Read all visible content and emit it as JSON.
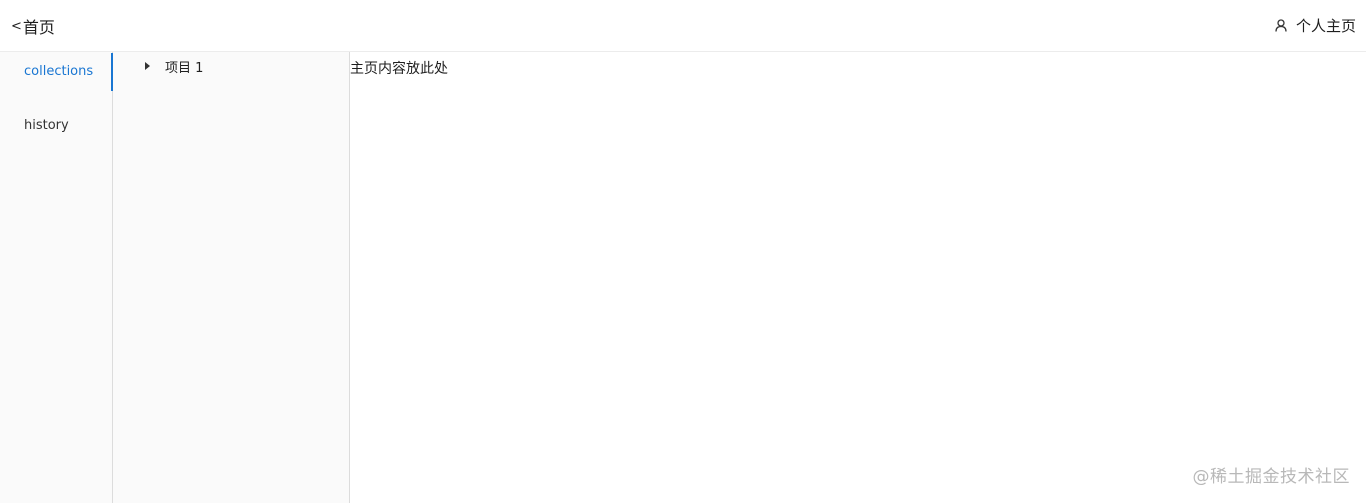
{
  "header": {
    "back_chevron": "<",
    "back_label": "首页",
    "profile_label": "个人主页",
    "profile_icon": "user-icon"
  },
  "sidebar": {
    "items": [
      {
        "label": "collections",
        "active": true
      },
      {
        "label": "history",
        "active": false
      }
    ],
    "accent_color": "#1976d2"
  },
  "tree": {
    "items": [
      {
        "label": "项目 1",
        "icon": "caret-right-icon",
        "expanded": false
      }
    ]
  },
  "main": {
    "content_text": "主页内容放此处"
  },
  "watermark": "@稀土掘金技术社区"
}
